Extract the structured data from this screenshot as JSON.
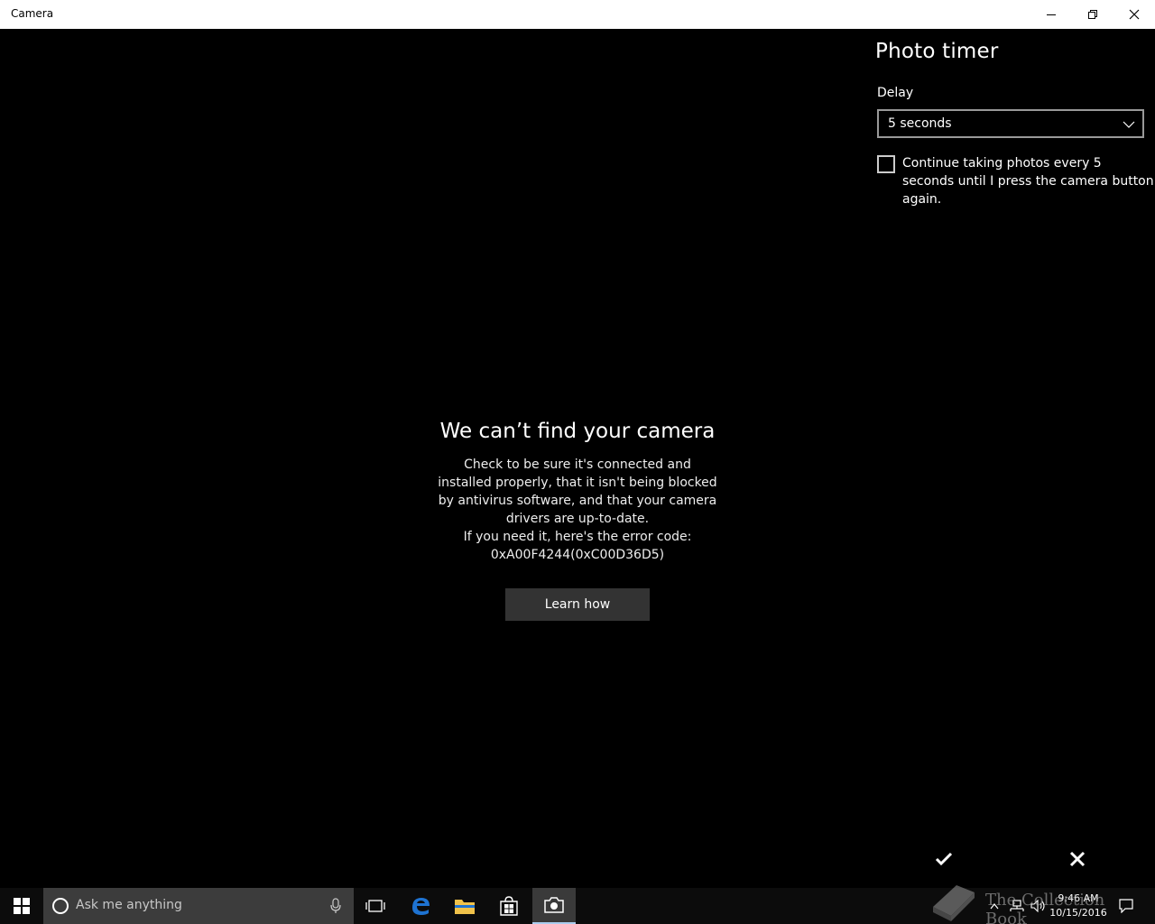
{
  "window": {
    "title": "Camera"
  },
  "panel": {
    "title": "Photo timer",
    "delay_label": "Delay",
    "delay_value": "5 seconds",
    "continuous_label": "Continue taking photos every 5 seconds until I press the camera button again.",
    "continuous_checked": false
  },
  "error": {
    "title": "We can’t find your camera",
    "line1": "Check to be sure it's connected and",
    "line2": "installed properly, that it isn't being blocked",
    "line3": "by antivirus software, and that your camera",
    "line4": "drivers are up-to-date.",
    "line5": "If you need it, here's the error code:",
    "code": "0xA00F4244(0xC00D36D5)",
    "learn_label": "Learn how"
  },
  "taskbar": {
    "search_placeholder": "Ask me anything",
    "apps": [
      "start-icon",
      "task-view-icon",
      "edge-icon",
      "file-explorer-icon",
      "store-icon",
      "camera-icon"
    ],
    "time": "9:46 AM",
    "date": "10/15/2016"
  },
  "watermark": {
    "text": "The Collection Book"
  },
  "colors": {
    "background": "#000000",
    "titlebar": "#ffffff",
    "button": "#333333",
    "taskbar": "#0c0c0c",
    "search": "#3c3c3c",
    "edge_blue": "#1e73d2",
    "folder_yellow": "#f0c24a"
  }
}
